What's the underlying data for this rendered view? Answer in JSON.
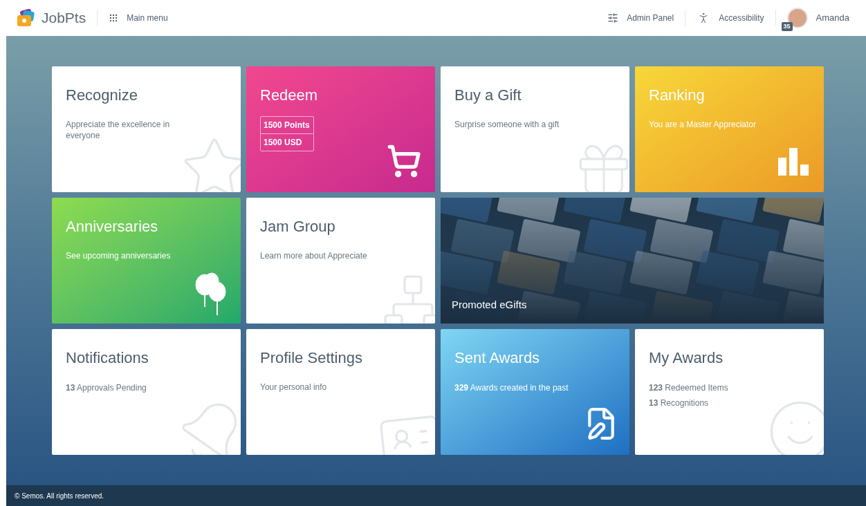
{
  "header": {
    "logo": "JobPts",
    "menu": "Main menu",
    "admin": "Admin Panel",
    "accessibility": "Accessibility",
    "badge": "35",
    "user": "Amanda"
  },
  "tiles": [
    {
      "kind": "white",
      "title": "Recognize",
      "text": "Appreciate the excellence in everyone"
    },
    {
      "kind": "pink",
      "title": "Redeem",
      "balances": [
        "1500 Points",
        "1500 USD"
      ]
    },
    {
      "kind": "white",
      "title": "Buy a Gift",
      "text": "Surprise someone with a gift"
    },
    {
      "kind": "yellow",
      "title": "Ranking",
      "text": "You are a Master Appreciator"
    },
    {
      "kind": "green",
      "title": "Anniversaries",
      "text": "See upcoming anniversaries"
    },
    {
      "kind": "white",
      "title": "Jam Group",
      "text": "Learn more about Appreciate"
    },
    {
      "kind": "photo",
      "title": "Promoted eGifts"
    },
    {
      "kind": "white",
      "title": "Notifications",
      "stats": [
        "**13** Approvals Pending"
      ]
    },
    {
      "kind": "white",
      "title": "Profile Settings",
      "text": "Your personal info"
    },
    {
      "kind": "blue",
      "title": "Sent Awards",
      "stats": [
        "**329** Awards created in the past"
      ]
    },
    {
      "kind": "white",
      "title": "My Awards",
      "stats": [
        "**123** Redeemed Items",
        "**13** Recognitions"
      ]
    }
  ],
  "footer": "© Semos. All rights reserved."
}
